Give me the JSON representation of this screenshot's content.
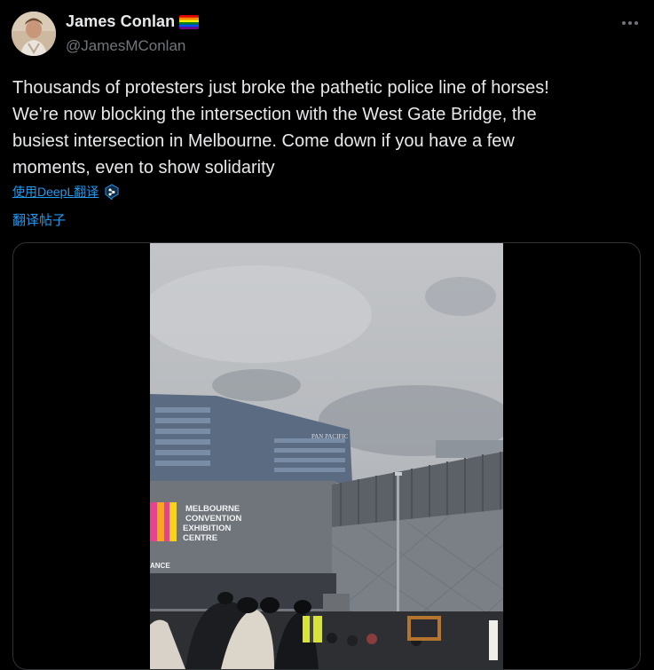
{
  "user": {
    "display_name": "James Conlan",
    "handle": "@JamesMConlan",
    "flag_icon": "rainbow-flag-icon",
    "avatar_icon": "profile-photo"
  },
  "menu": {
    "icon": "more-horizontal-icon"
  },
  "tweet": {
    "text": "Thousands of protesters just broke the pathetic police line of horses!\nWe’re now blocking the intersection with the West Gate Bridge, the\nbusiest intersection in Melbourne. Come down if you have a few\nmoments, even to show solidarity"
  },
  "translate": {
    "deepl_label": "使用DeepL翻译",
    "deepl_icon": "deepl-logo-icon",
    "post_label": "翻译帖子"
  },
  "media": {
    "sign_line1": "MELBOURNE",
    "sign_line2": "CONVENTION",
    "sign_line3": "EXHIBITION",
    "sign_line4": "CENTRE",
    "hotel_sign": "PAN PACIFIC",
    "entrance_fragment": "ANCE"
  },
  "colors": {
    "background": "#000000",
    "text": "#e7e9ea",
    "secondary": "#71767b",
    "link": "#1d9bf0",
    "border": "#2f3336"
  }
}
